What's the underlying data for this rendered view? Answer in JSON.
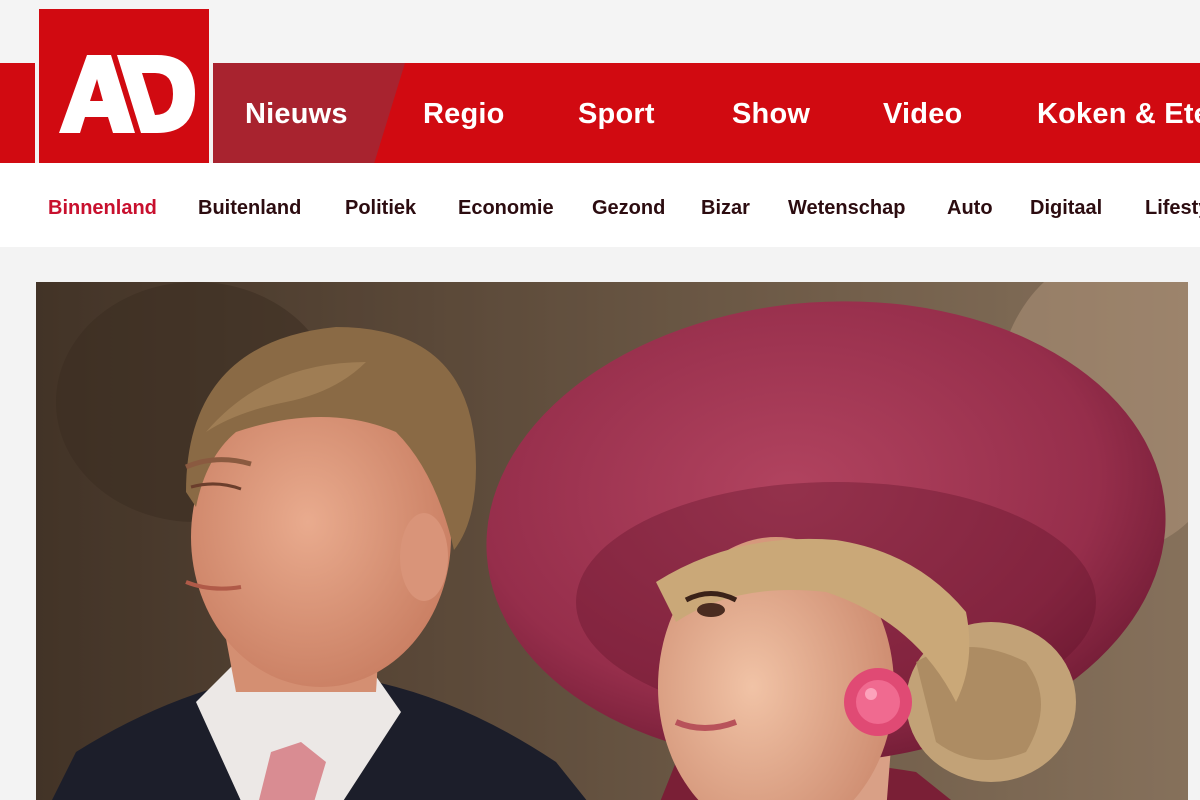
{
  "logo": {
    "text": "AD",
    "color": "#d10a11"
  },
  "main_nav": {
    "active_index": 0,
    "items": [
      "Nieuws",
      "Regio",
      "Sport",
      "Show",
      "Video",
      "Koken & Eten"
    ]
  },
  "sub_nav": {
    "active_index": 0,
    "items": [
      "Binnenland",
      "Buitenland",
      "Politiek",
      "Economie",
      "Gezond",
      "Bizar",
      "Wetenschap",
      "Auto",
      "Digitaal",
      "Lifestyle"
    ]
  },
  "colors": {
    "brand_red": "#d10a11",
    "active_tab": "#a8232f",
    "sub_nav_active": "#c8102e",
    "sub_nav_text": "#2c0c10"
  },
  "hero": {
    "icon": "photo"
  }
}
